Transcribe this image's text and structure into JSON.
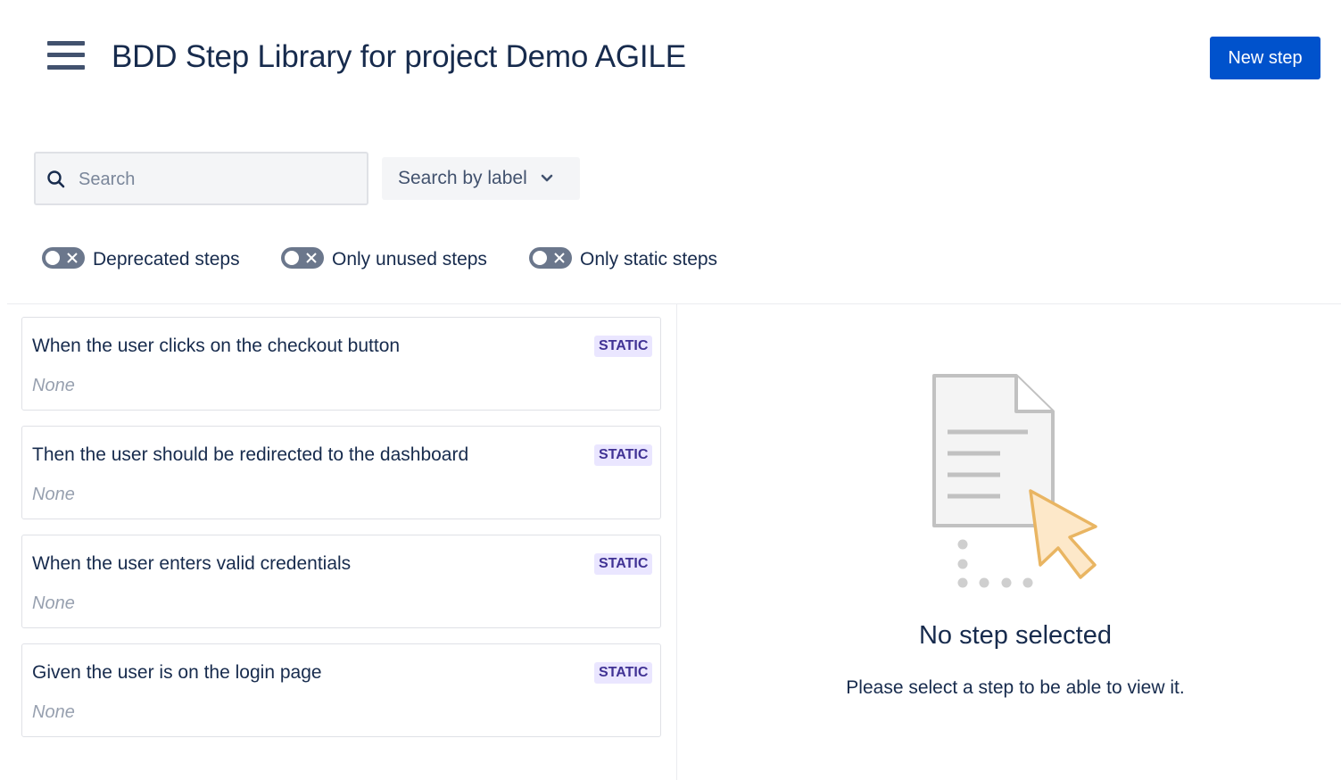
{
  "header": {
    "title": "BDD Step Library for project Demo AGILE",
    "new_step_label": "New step",
    "menu_icon": "hamburger-menu-icon"
  },
  "filters": {
    "search_placeholder": "Search",
    "search_value": "",
    "search_icon": "search-icon",
    "label_dropdown": "Search by label",
    "toggles": [
      {
        "label": "Deprecated steps",
        "on": false
      },
      {
        "label": "Only unused steps",
        "on": false
      },
      {
        "label": "Only static steps",
        "on": false
      }
    ]
  },
  "steps": [
    {
      "title": "When the user clicks on the checkout button",
      "description": "None",
      "badge": "STATIC"
    },
    {
      "title": "Then the user should be redirected to the dashboard",
      "description": "None",
      "badge": "STATIC"
    },
    {
      "title": "When the user enters valid credentials",
      "description": "None",
      "badge": "STATIC"
    },
    {
      "title": "Given the user is on the login page",
      "description": "None",
      "badge": "STATIC"
    }
  ],
  "detail": {
    "empty_title": "No step selected",
    "empty_message": "Please select a step to be able to view it.",
    "illustration_icon": "document-pointer-icon"
  },
  "colors": {
    "primary": "#0052cc",
    "text": "#172b4d",
    "badge_bg": "#eae6ff",
    "badge_text": "#403294",
    "toggle_off": "#6b778c"
  }
}
